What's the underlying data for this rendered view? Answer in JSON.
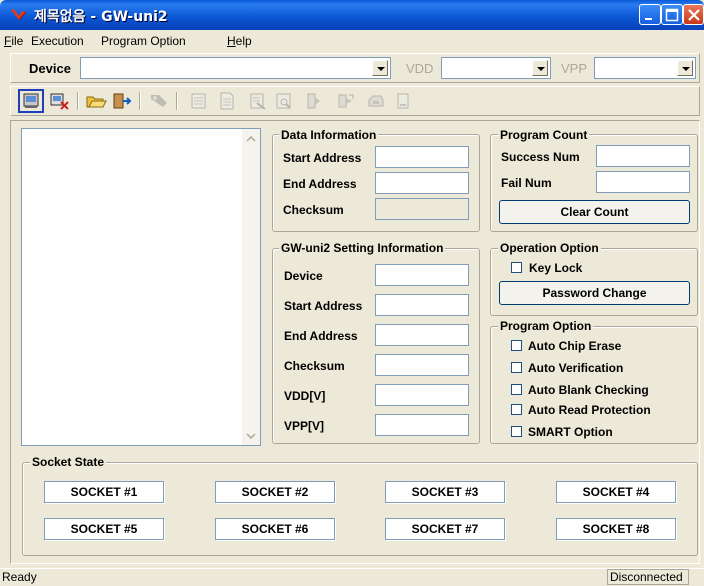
{
  "window": {
    "title": "제목없음 - GW-uni2"
  },
  "menu": [
    {
      "underline": "F",
      "rest": "ile"
    },
    {
      "underline": "",
      "rest": "Execution"
    },
    {
      "underline": "",
      "rest": "Program Option"
    },
    {
      "underline": "H",
      "rest": "elp"
    }
  ],
  "devicebar": {
    "device_label": "Device",
    "vdd_label": "VDD",
    "vpp_label": "VPP",
    "device_value": "",
    "vdd_value": "",
    "vpp_value": ""
  },
  "toolbar": {
    "icons": [
      "read-device-icon",
      "erase-icon",
      "open-file-icon",
      "exit-icon",
      "program-icon",
      "blank-check-icon",
      "verify-icon",
      "read-icon",
      "view-icon",
      "protect-icon",
      "auto-icon",
      "chip-icon",
      "memory-icon"
    ]
  },
  "data_info": {
    "legend": "Data Information",
    "start_label": "Start Address",
    "end_label": "End Address",
    "checksum_label": "Checksum",
    "start_value": "",
    "end_value": "",
    "checksum_value": ""
  },
  "program_count": {
    "legend": "Program Count",
    "success_label": "Success Num",
    "fail_label": "Fail Num",
    "success_value": "",
    "fail_value": "",
    "clear_button": "Clear Count"
  },
  "setting_info": {
    "legend": "GW-uni2 Setting Information",
    "device_label": "Device",
    "start_label": "Start Address",
    "end_label": "End Address",
    "checksum_label": "Checksum",
    "vdd_label": "VDD[V]",
    "vpp_label": "VPP[V]",
    "device_value": "",
    "start_value": "",
    "end_value": "",
    "checksum_value": "",
    "vdd_value": "",
    "vpp_value": ""
  },
  "operation_option": {
    "legend": "Operation Option",
    "key_lock": "Key Lock",
    "key_lock_checked": false,
    "password_button": "Password Change"
  },
  "program_option": {
    "legend": "Program Option",
    "options": [
      {
        "label": "Auto Chip Erase",
        "checked": false
      },
      {
        "label": "Auto Verification",
        "checked": false
      },
      {
        "label": "Auto Blank Checking",
        "checked": false
      },
      {
        "label": "Auto Read Protection",
        "checked": false
      },
      {
        "label": "SMART Option",
        "checked": false
      }
    ]
  },
  "socket_state": {
    "legend": "Socket State",
    "sockets": [
      "SOCKET #1",
      "SOCKET #2",
      "SOCKET #3",
      "SOCKET #4",
      "SOCKET #5",
      "SOCKET #6",
      "SOCKET #7",
      "SOCKET #8"
    ]
  },
  "status": {
    "left": "Ready",
    "right": "Disconnected"
  },
  "colors": {
    "titlebar": "#0a55d2",
    "face": "#ece9d8",
    "field_border": "#7f9db9",
    "button_border": "#003c74"
  }
}
